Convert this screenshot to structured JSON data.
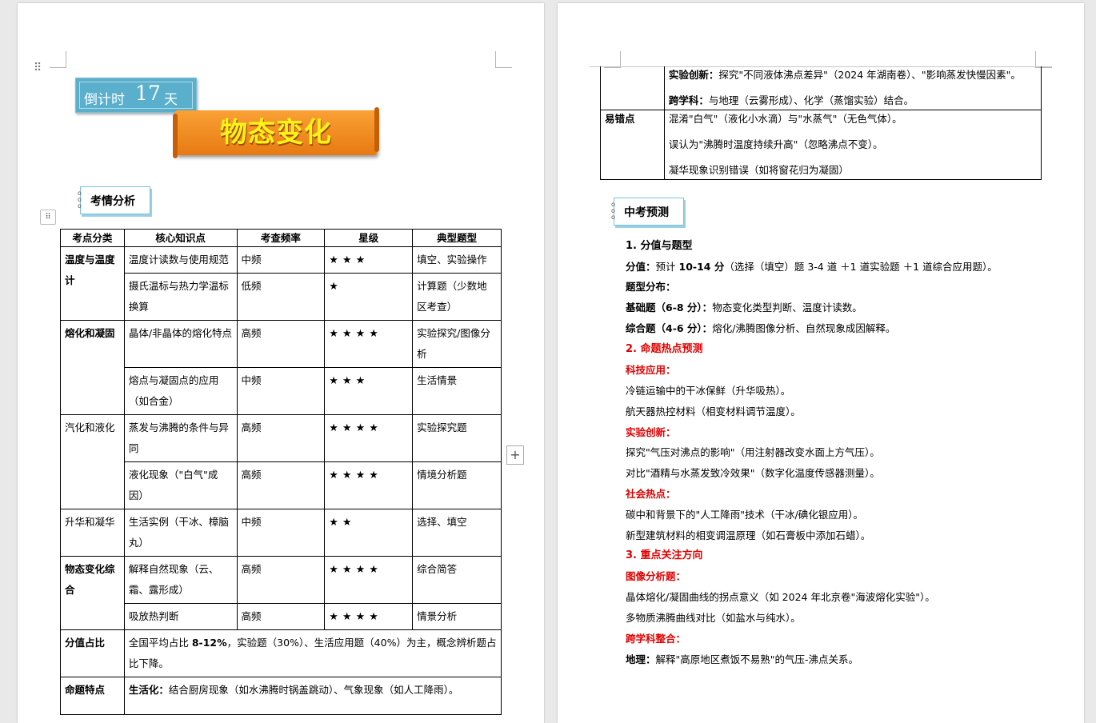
{
  "countdown": {
    "prefix": "倒计时",
    "number": "17",
    "suffix": "天"
  },
  "banner_title": "物态变化",
  "section1_title": "考情分析",
  "table": {
    "headers": [
      "考点分类",
      "核心知识点",
      "考查频率",
      "星级",
      "典型题型"
    ],
    "groups": [
      {
        "category": "温度与温度计",
        "category_bold": true,
        "rows": [
          {
            "point": "温度计读数与使用规范",
            "freq": "中频",
            "stars": "★★★",
            "type": "填空、实验操作"
          },
          {
            "point": "摄氏温标与热力学温标换算",
            "freq": "低频",
            "stars": "★",
            "type": "计算题（少数地区考查）"
          }
        ]
      },
      {
        "category": "熔化和凝固",
        "category_bold": true,
        "rows": [
          {
            "point": "晶体/非晶体的熔化特点",
            "freq": "高频",
            "stars": "★★★★",
            "type": "实验探究/图像分析"
          },
          {
            "point": "熔点与凝固点的应用（如合金）",
            "freq": "中频",
            "stars": "★★★",
            "type": "生活情景"
          }
        ]
      },
      {
        "category": "汽化和液化",
        "category_bold": false,
        "rows": [
          {
            "point": "蒸发与沸腾的条件与异同",
            "freq": "高频",
            "stars": "★★★★",
            "type": "实验探究题"
          },
          {
            "point": "液化现象（\"白气\"成因）",
            "freq": "高频",
            "stars": "★★★★",
            "type": "情境分析题"
          }
        ]
      },
      {
        "category": "升华和凝华",
        "category_bold": false,
        "rows": [
          {
            "point": "生活实例（干冰、樟脑丸）",
            "freq": "中频",
            "stars": "★★",
            "type": "选择、填空"
          }
        ]
      },
      {
        "category": "物态变化综合",
        "category_bold": true,
        "rows": [
          {
            "point": "解释自然现象（云、霜、露形成）",
            "freq": "高频",
            "stars": "★★★★",
            "type": "综合简答"
          },
          {
            "point": "吸放热判断",
            "freq": "高频",
            "stars": "★★★★",
            "type": "情景分析"
          }
        ]
      }
    ],
    "score_label": "分值占比",
    "score_pre": "全国平均占比 ",
    "score_bold": "8-12%",
    "score_post": "，实验题（30%）、生活应用题（40%）为主，概念辨析题占比下降。",
    "feature_label": "命题特点",
    "feature_bold": "生活化：",
    "feature_text": "结合厨房现象（如水沸腾时锅盖跳动）、气象现象（如人工降雨）。"
  },
  "cont_table": {
    "row1": [
      {
        "bold": "实验创新：",
        "text": "探究\"不同液体沸点差异\"（2024 年湖南卷）、\"影响蒸发快慢因素\"。"
      },
      {
        "bold": "跨学科：",
        "text": "与地理（云雾形成）、化学（蒸馏实验）结合。"
      }
    ],
    "row2_label": "易错点",
    "row2": [
      "混淆\"白气\"（液化小水滴）与\"水蒸气\"（无色气体）。",
      "误认为\"沸腾时温度持续升高\"（忽略沸点不变）。",
      "凝华现象识别错误（如将窗花归为凝固）"
    ]
  },
  "section2_title": "中考预测",
  "forecast": {
    "h1": "1.  分值与题型",
    "score_label": "分值：",
    "score_pre": "预计 ",
    "score_bold": "10-14 分",
    "score_post": "（选择（填空）题 3-4 道 ＋1 道实验题 ＋1 道综合应用题）。",
    "types_label": "题型分布：",
    "basic_label": "基础题（6-8 分）：",
    "basic_text": "物态变化类型判断、温度计读数。",
    "comp_label": "综合题（4-6 分）：",
    "comp_text": "熔化/沸腾图像分析、自然现象成因解释。",
    "h2": "2.  命题热点预测",
    "tech_label": "科技应用：",
    "tech_1": "冷链运输中的干冰保鲜（升华吸热）。",
    "tech_2": "航天器热控材料（相变材料调节温度）。",
    "exp_label": "实验创新：",
    "exp_1": "探究\"气压对沸点的影响\"（用注射器改变水面上方气压）。",
    "exp_2": "对比\"酒精与水蒸发致冷效果\"（数字化温度传感器测量）。",
    "soc_label": "社会热点：",
    "soc_1": "碳中和背景下的\"人工降雨\"技术（干冰/碘化银应用）。",
    "soc_2": "新型建筑材料的相变调温原理（如石膏板中添加石蜡）。",
    "h3": "3.  重点关注方向",
    "img_label": "图像分析题：",
    "img_1": "晶体熔化/凝固曲线的拐点意义（如 2024 年北京卷\"海波熔化实验\"）。",
    "img_2": "多物质沸腾曲线对比（如盐水与纯水）。",
    "cross_label": "跨学科整合：",
    "geo_label": "地理：",
    "geo_text": "解释\"高原地区煮饭不易熟\"的气压-沸点关系。"
  }
}
